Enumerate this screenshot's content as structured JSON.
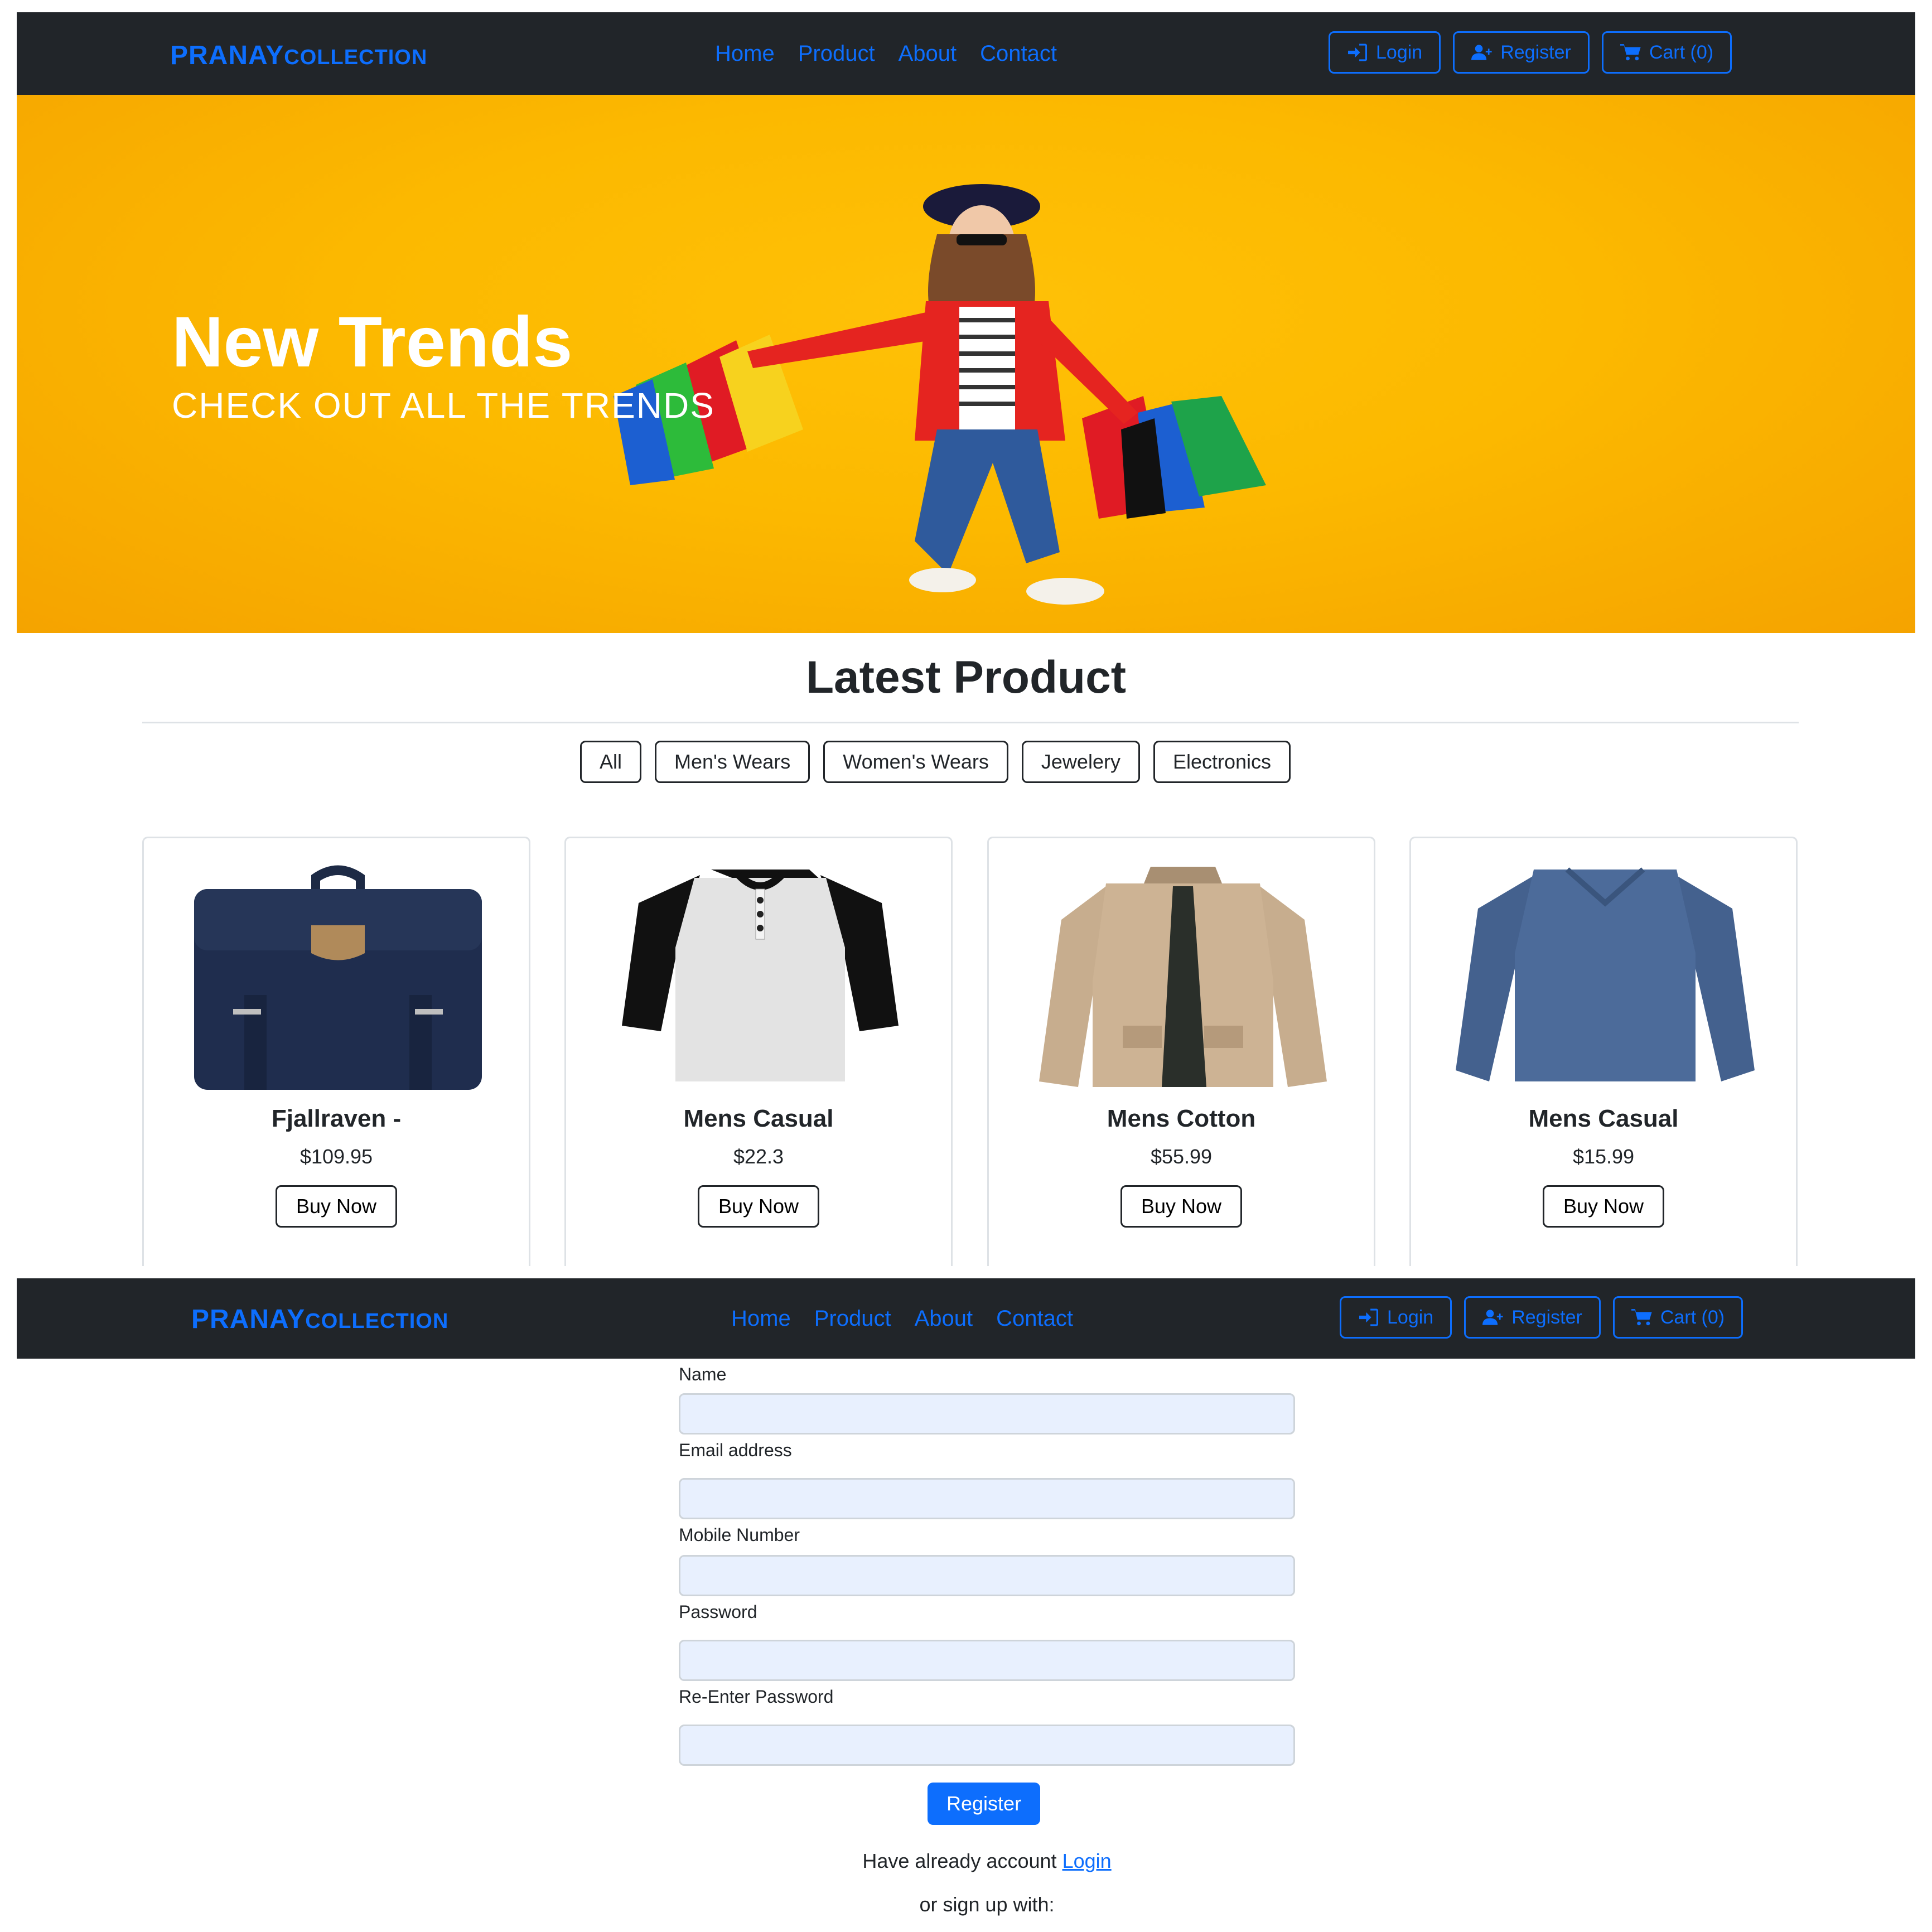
{
  "brand": {
    "main": "PRANAY",
    "sub": "COLLECTION",
    "color": "#0d6efd"
  },
  "nav": {
    "links": [
      "Home",
      "Product",
      "About",
      "Contact"
    ],
    "login": "Login",
    "register": "Register",
    "cart": "Cart (0)"
  },
  "hero": {
    "title": "New Trends",
    "subtitle": "CHECK OUT ALL THE TRENDS",
    "background": "#fcb900"
  },
  "products": {
    "heading": "Latest Product",
    "filters": [
      "All",
      "Men's Wears",
      "Women's Wears",
      "Jewelery",
      "Electronics"
    ],
    "items": [
      {
        "title": "Fjallraven -",
        "price": "$109.95",
        "button": "Buy Now",
        "image": "backpack-icon"
      },
      {
        "title": "Mens Casual",
        "price": "$22.3",
        "button": "Buy Now",
        "image": "tshirt-icon"
      },
      {
        "title": "Mens Cotton",
        "price": "$55.99",
        "button": "Buy Now",
        "image": "jacket-icon"
      },
      {
        "title": "Mens Casual",
        "price": "$15.99",
        "button": "Buy Now",
        "image": "sweater-icon"
      }
    ]
  },
  "register_form": {
    "fields": [
      {
        "label": "Name",
        "value": ""
      },
      {
        "label": "Email address",
        "value": ""
      },
      {
        "label": "Mobile Number",
        "value": ""
      },
      {
        "label": "Password",
        "value": ""
      },
      {
        "label": "Re-Enter Password",
        "value": ""
      }
    ],
    "submit": "Register",
    "already_text": "Have already account",
    "login_link": "Login",
    "signup_with": "or sign up with:"
  }
}
